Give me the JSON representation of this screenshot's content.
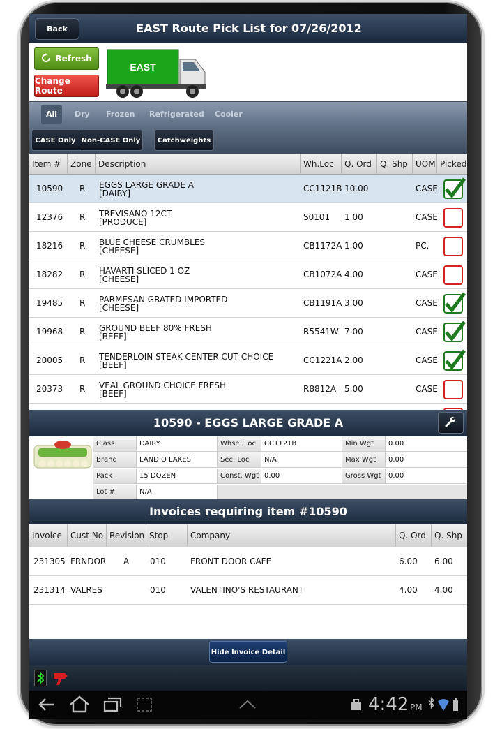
{
  "header": {
    "back_label": "Back",
    "title": "EAST Route Pick List for 07/26/2012"
  },
  "actions": {
    "refresh_label": "Refresh",
    "change_route_label": "Change Route",
    "route_name": "EAST"
  },
  "tabs": [
    {
      "label": "All",
      "active": true
    },
    {
      "label": "Dry"
    },
    {
      "label": "Frozen"
    },
    {
      "label": "Refrigerated"
    },
    {
      "label": "Cooler"
    }
  ],
  "filters": {
    "case_only": "CASE Only",
    "non_case_only": "Non-CASE Only",
    "catchweights": "Catchweights"
  },
  "table": {
    "columns": [
      "Item #",
      "Zone",
      "Description",
      "Wh.Loc",
      "Q. Ord",
      "Q. Shp",
      "UOM",
      "Picked"
    ],
    "rows": [
      {
        "item": "10590",
        "zone": "R",
        "desc": "EGGS LARGE GRADE A",
        "cat": "[DAIRY]",
        "loc": "CC1121B",
        "ord": "10.00",
        "shp": "",
        "uom": "CASE",
        "picked": true
      },
      {
        "item": "12376",
        "zone": "R",
        "desc": "TREVISANO 12CT",
        "cat": "[PRODUCE]",
        "loc": "S0101",
        "ord": "1.00",
        "shp": "",
        "uom": "CASE",
        "picked": false
      },
      {
        "item": "18216",
        "zone": "R",
        "desc": "BLUE CHEESE CRUMBLES",
        "cat": "[CHEESE]",
        "loc": "CB1172A",
        "ord": "1.00",
        "shp": "",
        "uom": "PC.",
        "picked": false
      },
      {
        "item": "18282",
        "zone": "R",
        "desc": "HAVARTI SLICED 1 OZ",
        "cat": "[CHEESE]",
        "loc": "CB1072A",
        "ord": "4.00",
        "shp": "",
        "uom": "CASE",
        "picked": false
      },
      {
        "item": "19485",
        "zone": "R",
        "desc": "PARMESAN GRATED IMPORTED",
        "cat": "[CHEESE]",
        "loc": "CB1191A",
        "ord": "3.00",
        "shp": "",
        "uom": "CASE",
        "picked": true
      },
      {
        "item": "19968",
        "zone": "R",
        "desc": "GROUND BEEF 80% FRESH",
        "cat": "[BEEF]",
        "loc": "R5541W",
        "ord": "7.00",
        "shp": "",
        "uom": "CASE",
        "picked": true
      },
      {
        "item": "20005",
        "zone": "R",
        "desc": "TENDERLOIN STEAK CENTER CUT CHOICE",
        "cat": "[BEEF]",
        "loc": "CC1221A",
        "ord": "2.00",
        "shp": "",
        "uom": "CASE",
        "picked": true
      },
      {
        "item": "20373",
        "zone": "R",
        "desc": "VEAL GROUND CHOICE FRESH",
        "cat": "[BEEF]",
        "loc": "R8812A",
        "ord": "5.00",
        "shp": "",
        "uom": "CASE",
        "picked": false
      }
    ]
  },
  "detail": {
    "title": "10590 - EGGS LARGE GRADE A",
    "class_label": "Class",
    "class": "DAIRY",
    "brand_label": "Brand",
    "brand": "LAND O LAKES",
    "pack_label": "Pack",
    "pack": "15 DOZEN",
    "lot_label": "Lot #",
    "lot": "N/A",
    "whse_label": "Whse. Loc",
    "whse": "CC1121B",
    "sec_label": "Sec. Loc",
    "sec": "N/A",
    "const_label": "Const. Wgt",
    "const": "0.00",
    "min_label": "Min Wgt",
    "min": "0.00",
    "max_label": "Max Wgt",
    "max": "0.00",
    "gross_label": "Gross Wgt",
    "gross": "0.00"
  },
  "invoices": {
    "title": "Invoices requiring item #10590",
    "columns": [
      "Invoice",
      "Cust No",
      "Revision",
      "Stop",
      "Company",
      "Q. Ord",
      "Q. Shp"
    ],
    "rows": [
      {
        "invoice": "231305",
        "cust": "FRNDOR",
        "rev": "A",
        "stop": "010",
        "company": "FRONT DOOR CAFE",
        "ord": "6.00",
        "shp": "6.00"
      },
      {
        "invoice": "231314",
        "cust": "VALRES",
        "rev": "",
        "stop": "010",
        "company": "VALENTINO'S RESTAURANT",
        "ord": "4.00",
        "shp": "4.00"
      }
    ],
    "hide_label": "Hide Invoice Detail"
  },
  "system": {
    "time": "4:42",
    "ampm": "PM"
  },
  "colors": {
    "picked": "#1e7a1e",
    "unpicked": "#d62020",
    "selected_row": "#d8e4ef"
  }
}
